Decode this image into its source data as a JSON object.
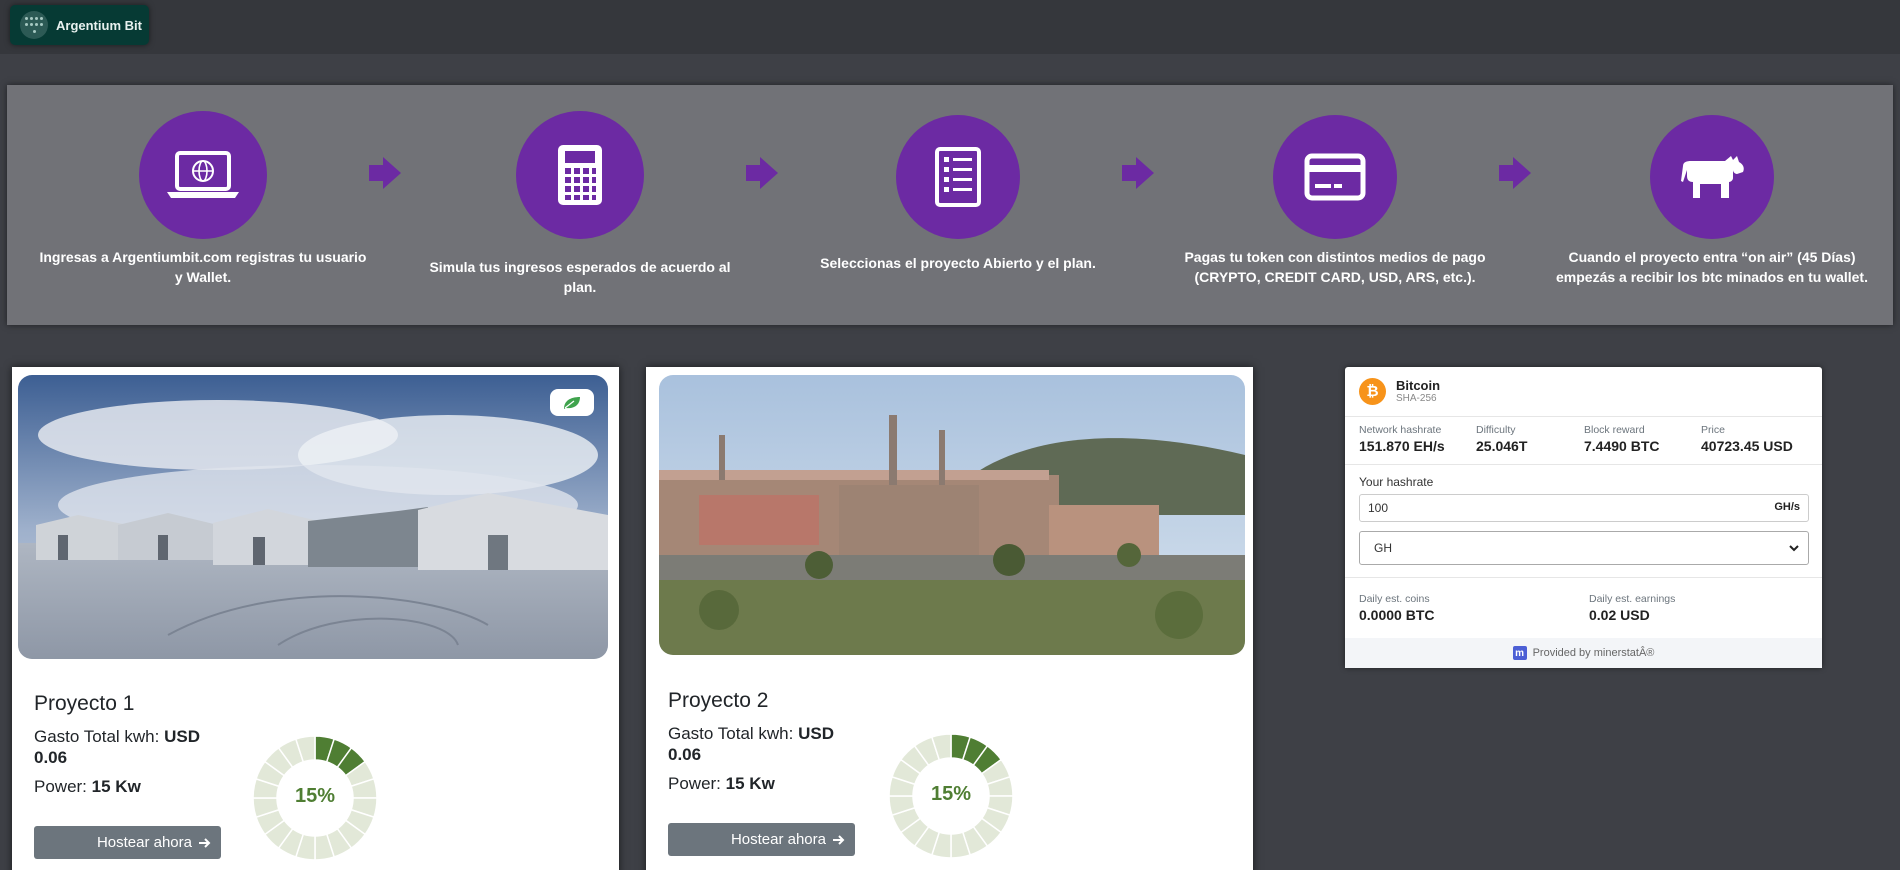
{
  "brand": {
    "name": "Argentium Bit"
  },
  "steps": [
    {
      "icon": "laptop-globe-icon",
      "text": "Ingresas a Argentiumbit.com registras tu usuario y Wallet."
    },
    {
      "icon": "calculator-icon",
      "text": "Simula tus ingresos esperados de acuerdo al plan."
    },
    {
      "icon": "checklist-icon",
      "text": "Seleccionas el proyecto Abierto y el plan."
    },
    {
      "icon": "credit-card-icon",
      "text": "Pagas tu token con distintos medios de pago (CRYPTO, CREDIT CARD, USD, ARS, etc.)."
    },
    {
      "icon": "cow-icon",
      "text": "Cuando el proyecto entra “on air” (45 Días) empezás a recibir los btc minados en tu wallet."
    }
  ],
  "colors": {
    "accent": "#6c2aa3",
    "progress": "#4f7e33",
    "progress_bg": "#e2e8d8"
  },
  "projects": [
    {
      "title": "Proyecto 1",
      "cost_label": "Gasto Total kwh:",
      "cost_value": "USD 0.06",
      "power_label": "Power:",
      "power_value": "15 Kw",
      "progress_label": "15%",
      "progress": 0.15,
      "button": "Hostear ahora",
      "badge_icon": "leaf-icon"
    },
    {
      "title": "Proyecto 2",
      "cost_label": "Gasto Total kwh:",
      "cost_value": "USD 0.06",
      "power_label": "Power:",
      "power_value": "15 Kw",
      "progress_label": "15%",
      "progress": 0.15,
      "button": "Hostear ahora"
    }
  ],
  "calculator": {
    "coin": "Bitcoin",
    "algo": "SHA-256",
    "stats": [
      {
        "label": "Network hashrate",
        "value": "151.870 EH/s"
      },
      {
        "label": "Difficulty",
        "value": "25.046T"
      },
      {
        "label": "Block reward",
        "value": "7.4490 BTC"
      },
      {
        "label": "Price",
        "value": "40723.45 USD"
      }
    ],
    "hashrate_label": "Your hashrate",
    "hashrate_value": "100",
    "hashrate_unit": "GH/s",
    "unit_selected": "GH",
    "daily_coins_label": "Daily est. coins",
    "daily_coins_value": "0.0000 BTC",
    "daily_earnings_label": "Daily est. earnings",
    "daily_earnings_value": "0.02 USD",
    "footer": "Provided by minerstatÂ®"
  }
}
